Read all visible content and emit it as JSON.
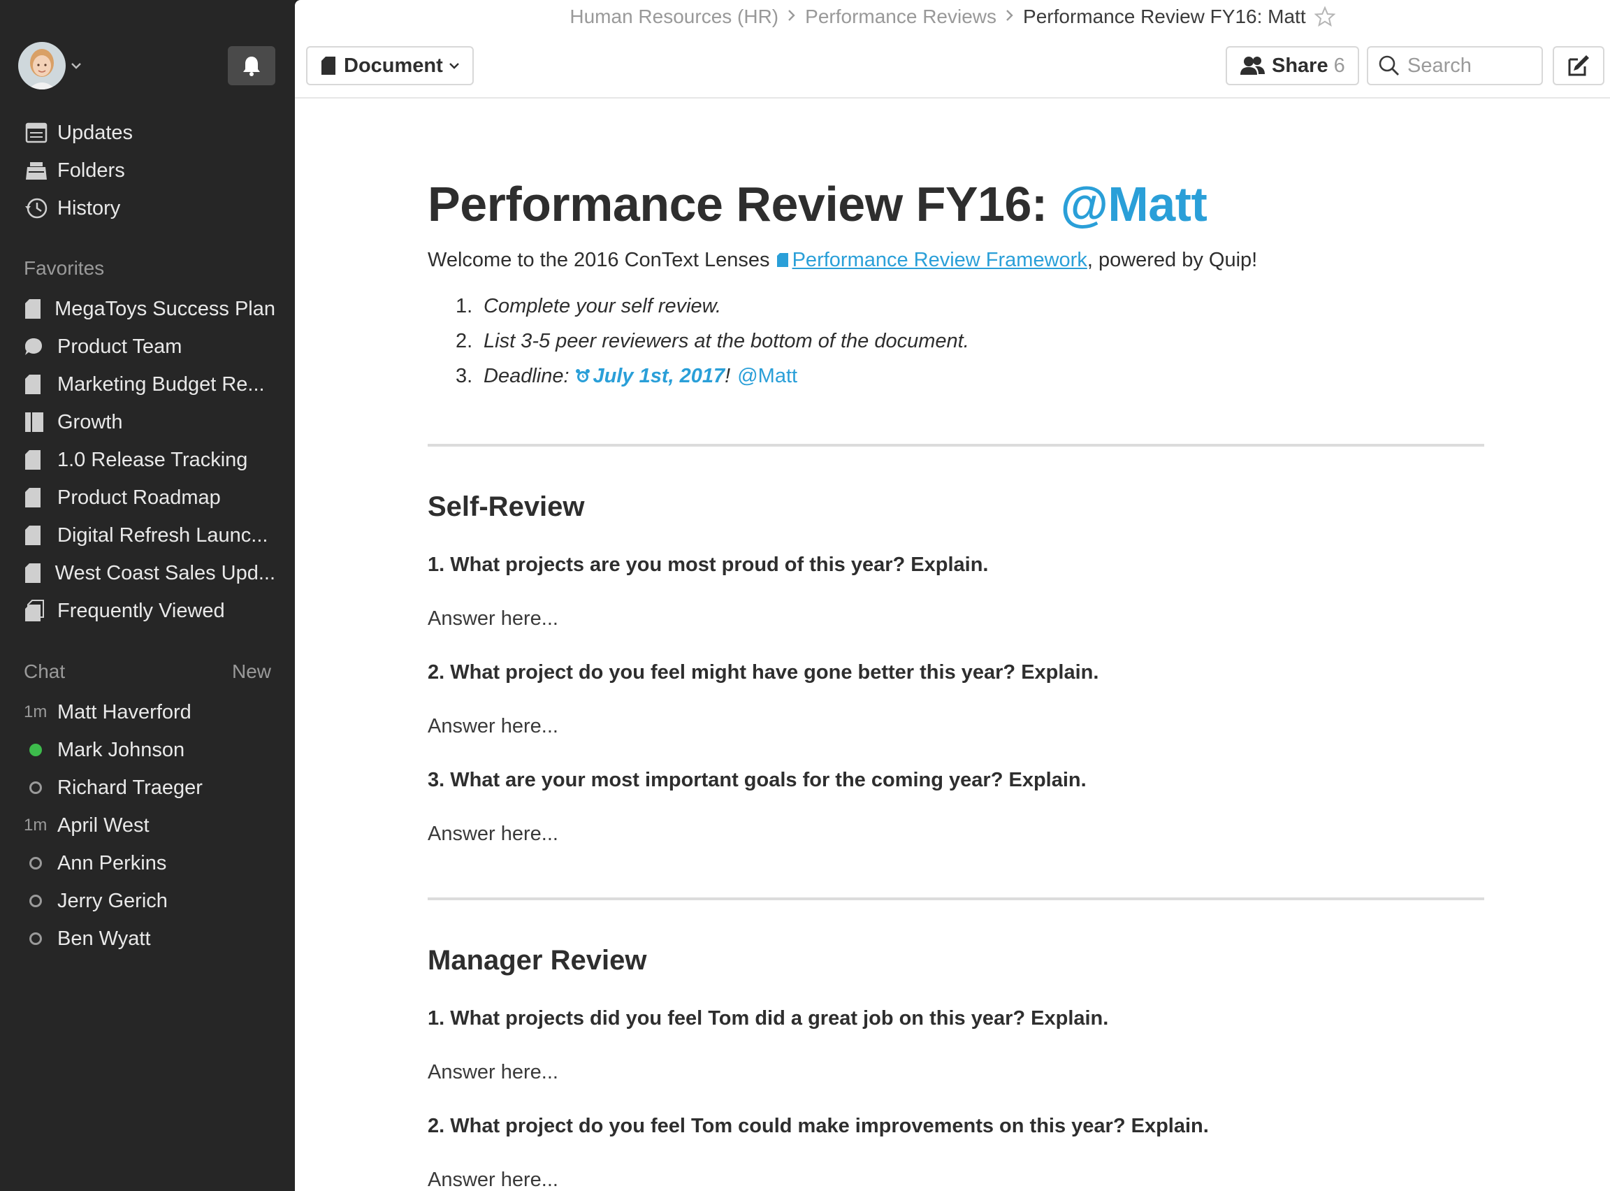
{
  "sidebar": {
    "nav": [
      {
        "label": "Updates",
        "icon": "updates-icon"
      },
      {
        "label": "Folders",
        "icon": "folders-icon"
      },
      {
        "label": "History",
        "icon": "history-icon"
      }
    ],
    "favorites_heading": "Favorites",
    "favorites": [
      {
        "label": "MegaToys Success Plan",
        "icon": "document-icon"
      },
      {
        "label": "Product Team",
        "icon": "chat-bubble-icon"
      },
      {
        "label": "Marketing Budget Re...",
        "icon": "document-icon"
      },
      {
        "label": "Growth",
        "icon": "folder-book-icon"
      },
      {
        "label": "1.0 Release Tracking",
        "icon": "document-icon"
      },
      {
        "label": "Product Roadmap",
        "icon": "document-icon"
      },
      {
        "label": "Digital Refresh Launc...",
        "icon": "document-icon"
      },
      {
        "label": "West Coast Sales Upd...",
        "icon": "document-icon"
      },
      {
        "label": "Frequently Viewed",
        "icon": "documents-stack-icon"
      }
    ],
    "chat_heading": "Chat",
    "chat_new": "New",
    "chats": [
      {
        "name": "Matt Haverford",
        "lead": "1m",
        "status": "recent"
      },
      {
        "name": "Mark Johnson",
        "lead": "",
        "status": "online"
      },
      {
        "name": "Richard Traeger",
        "lead": "",
        "status": "offline"
      },
      {
        "name": "April West",
        "lead": "1m",
        "status": "recent"
      },
      {
        "name": "Ann Perkins",
        "lead": "",
        "status": "offline"
      },
      {
        "name": "Jerry Gerich",
        "lead": "",
        "status": "offline"
      },
      {
        "name": "Ben Wyatt",
        "lead": "",
        "status": "offline"
      }
    ]
  },
  "header": {
    "breadcrumb": [
      "Human Resources (HR)",
      "Performance Reviews"
    ],
    "current": "Performance Review FY16: Matt",
    "doc_button": "Document",
    "share_label": "Share",
    "share_count": "6",
    "search_placeholder": "Search"
  },
  "doc": {
    "title": "Performance Review FY16: ",
    "title_mention": "@Matt",
    "intro_before": "Welcome to the 2016 ConText Lenses ",
    "intro_link": "Performance Review Framework",
    "intro_after": ",  powered by Quip!",
    "steps": [
      {
        "num": "1.",
        "text": "Complete your self review."
      },
      {
        "num": "2.",
        "text": "List 3-5 peer reviewers at the bottom of the document."
      }
    ],
    "step3_num": "3.",
    "step3_prefix": "Deadline: ",
    "step3_date": "July 1st, 2017",
    "step3_suffix": "!",
    "step3_mention": "@Matt",
    "sections": [
      {
        "heading": "Self-Review",
        "items": [
          {
            "q": "1. What projects are you most proud of this year? Explain.",
            "a": "Answer here..."
          },
          {
            "q": "2. What project do you feel might have gone better this year? Explain.",
            "a": "Answer here..."
          },
          {
            "q": "3. What are your most important goals for the coming year? Explain.",
            "a": "Answer here..."
          }
        ]
      },
      {
        "heading": "Manager Review",
        "items": [
          {
            "q": "1. What projects did you feel Tom did a great job on this year? Explain.",
            "a": "Answer here..."
          },
          {
            "q": "2. What project do you feel Tom could make improvements on this year? Explain.",
            "a": "Answer here..."
          }
        ]
      }
    ]
  },
  "colors": {
    "sidebar_bg": "#262626",
    "accent": "#2a9fd8",
    "online": "#3dbb4c"
  }
}
